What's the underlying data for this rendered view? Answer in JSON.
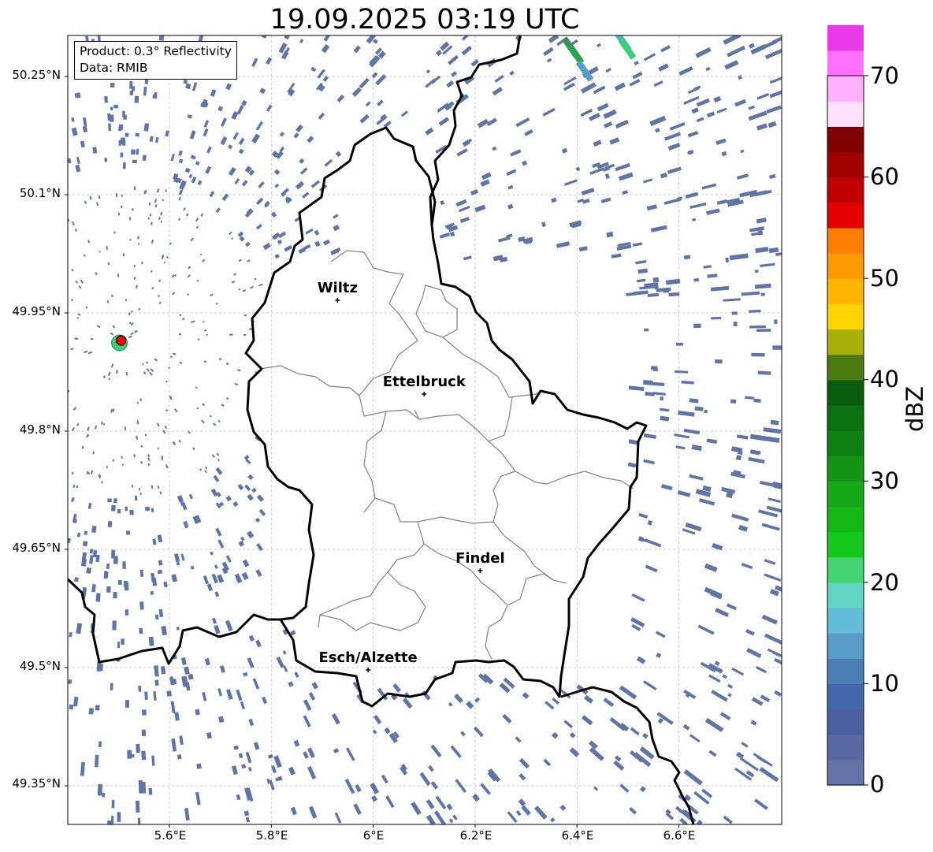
{
  "title": "19.09.2025 03:19 UTC",
  "info": {
    "product": "Product: 0.3° Reflectivity",
    "data": "Data: RMIB"
  },
  "axes": {
    "lat_ticks": [
      "50.25°N",
      "50.1°N",
      "49.95°N",
      "49.8°N",
      "49.65°N",
      "49.5°N",
      "49.35°N"
    ],
    "lon_ticks": [
      "5.6°E",
      "5.8°E",
      "6°E",
      "6.2°E",
      "6.4°E",
      "6.6°E"
    ]
  },
  "cities": [
    {
      "name": "Wiltz",
      "lon": 5.93,
      "lat": 49.966
    },
    {
      "name": "Ettelbruck",
      "lon": 6.1,
      "lat": 49.847
    },
    {
      "name": "Findel",
      "lon": 6.21,
      "lat": 49.623
    },
    {
      "name": "Esch/Alzette",
      "lon": 5.99,
      "lat": 49.497
    }
  ],
  "radar_site": {
    "lon": 5.505,
    "lat": 49.915
  },
  "colorbar": {
    "label": "dBZ",
    "ticks": [
      "0",
      "10",
      "20",
      "30",
      "40",
      "50",
      "60",
      "70"
    ],
    "min": 0,
    "max": 70,
    "step": 2.5,
    "colors": [
      "#6474a8",
      "#5868a0",
      "#4b60a0",
      "#4466aa",
      "#4a7eb4",
      "#5a9cc8",
      "#62bcd8",
      "#62d4c4",
      "#44d474",
      "#16c81e",
      "#14b816",
      "#16a816",
      "#149414",
      "#0e8012",
      "#0a7010",
      "#085c0c",
      "#4a7a10",
      "#aab00a",
      "#ffd400",
      "#ffb400",
      "#ff9a00",
      "#ff7e00",
      "#e40000",
      "#c00000",
      "#a00000",
      "#800000",
      "#ffe0ff",
      "#ffb0ff",
      "#ff70ff",
      "#e838e8"
    ]
  },
  "colors": {
    "light_echo": "#6174a6",
    "border": "#000000",
    "cantons": "#808080"
  }
}
